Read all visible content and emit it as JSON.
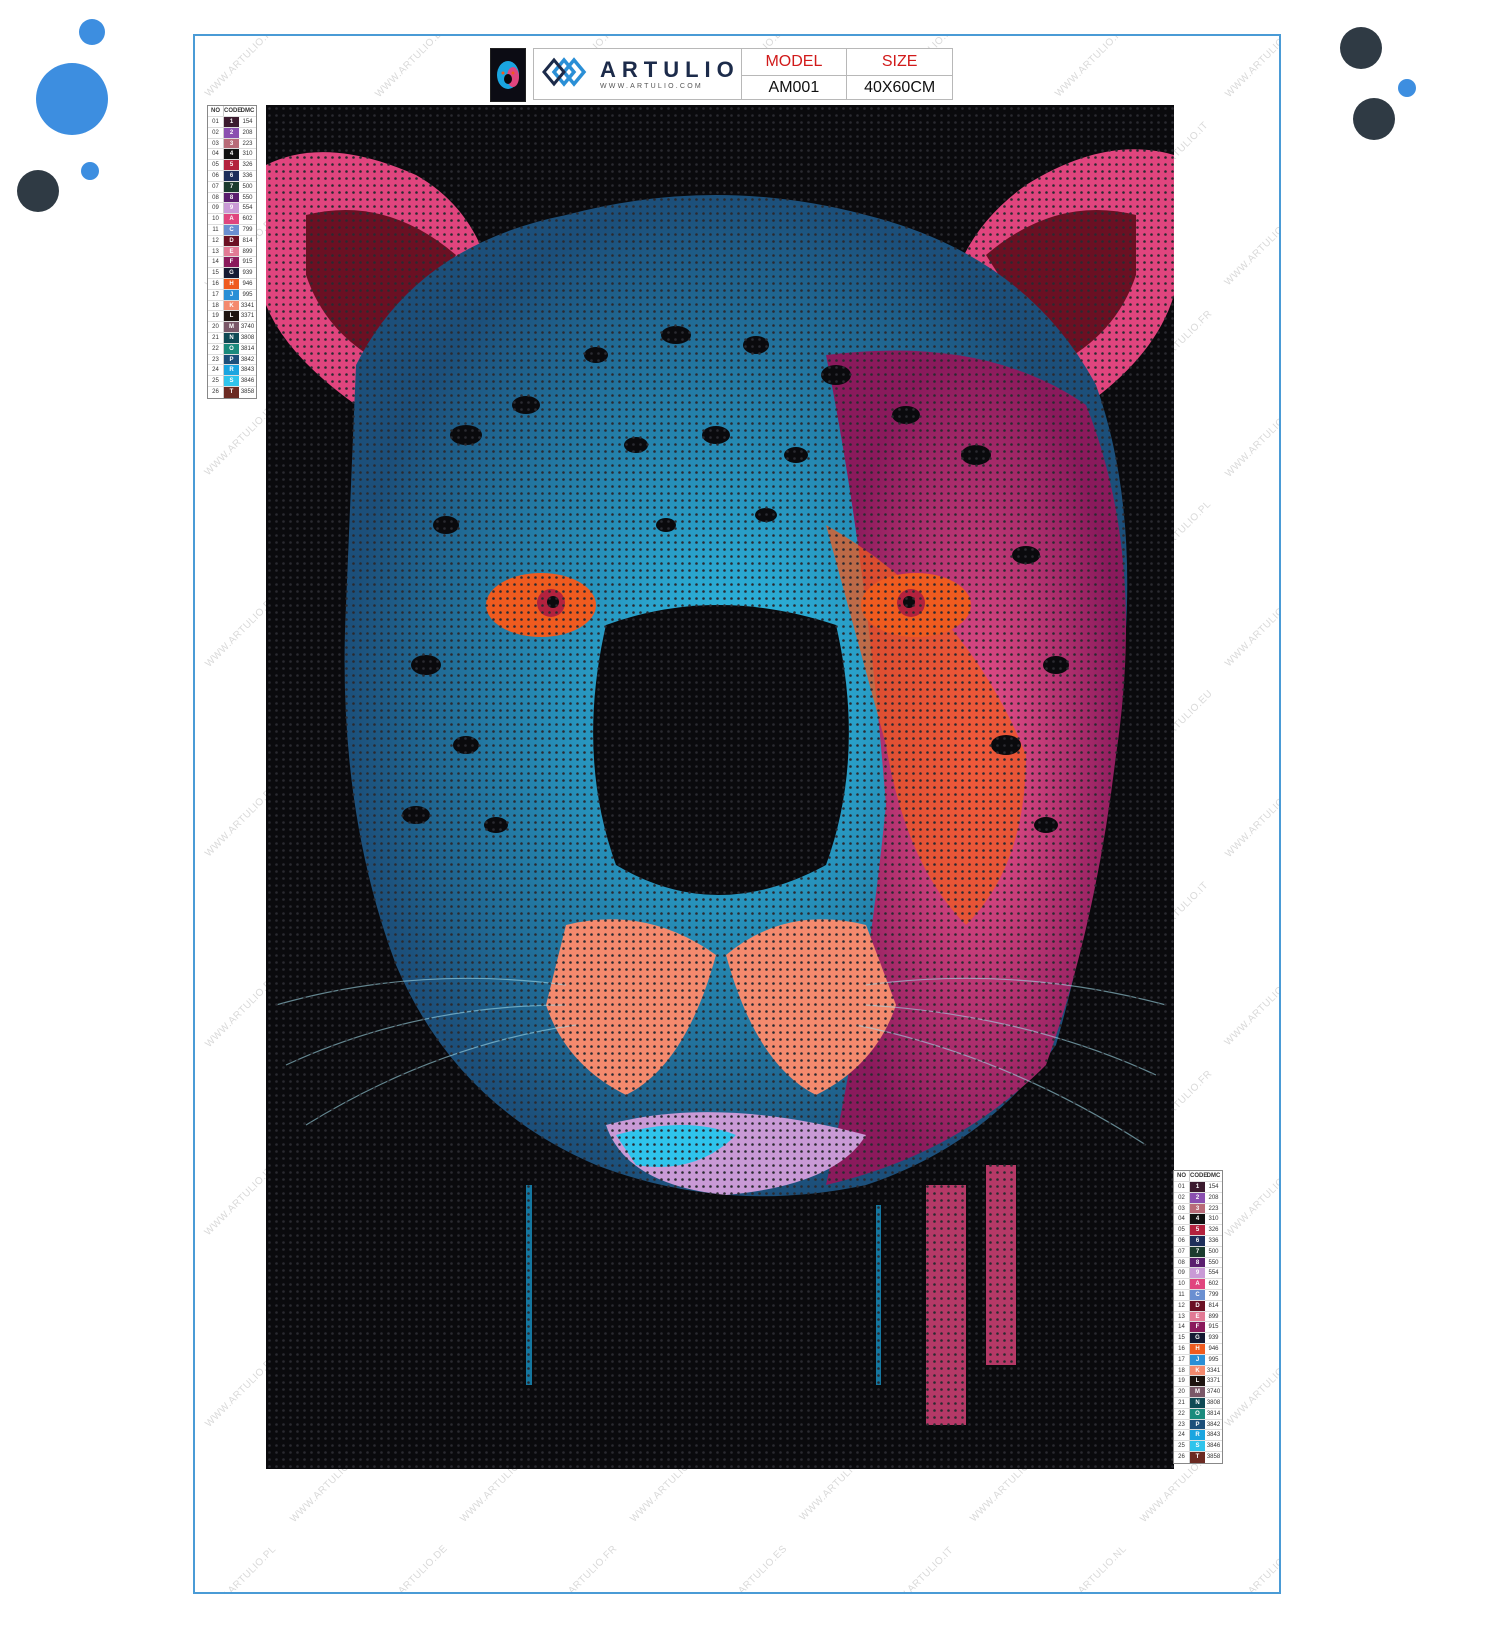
{
  "decor": {
    "blue": "#3d8ee0",
    "dark": "#2f3a44"
  },
  "brand": {
    "name": "ARTULIO",
    "url": "WWW.ARTULIO.COM",
    "logo_icon": "diamond-logo-icon"
  },
  "product": {
    "model_label": "MODEL",
    "model_value": "AM001",
    "size_label": "SIZE",
    "size_value": "40X60CM"
  },
  "watermark": {
    "texts": [
      "WWW.ARTULIO.PL",
      "WWW.ARTULIO.DE",
      "WWW.ARTULIO.FR",
      "WWW.ARTULIO.ES",
      "WWW.ARTULIO.IT",
      "WWW.ARTULIO.NL",
      "WWW.ARTULIO.EU",
      "WWW.ARTULIO.CO.UK"
    ]
  },
  "legend": {
    "headers": [
      "NO",
      "CODE",
      "DMC"
    ],
    "rows": [
      {
        "no": "01",
        "code": "1",
        "dmc": "154",
        "color": "#3b1a2e"
      },
      {
        "no": "02",
        "code": "2",
        "dmc": "208",
        "color": "#8b4fb0"
      },
      {
        "no": "03",
        "code": "3",
        "dmc": "223",
        "color": "#b86b78"
      },
      {
        "no": "04",
        "code": "4",
        "dmc": "310",
        "color": "#111111"
      },
      {
        "no": "05",
        "code": "5",
        "dmc": "326",
        "color": "#b3223e"
      },
      {
        "no": "06",
        "code": "6",
        "dmc": "336",
        "color": "#1d2e5a"
      },
      {
        "no": "07",
        "code": "7",
        "dmc": "500",
        "color": "#1b3b2e"
      },
      {
        "no": "08",
        "code": "8",
        "dmc": "550",
        "color": "#5a1e6e"
      },
      {
        "no": "09",
        "code": "9",
        "dmc": "554",
        "color": "#c99ad6"
      },
      {
        "no": "10",
        "code": "A",
        "dmc": "602",
        "color": "#e0457e"
      },
      {
        "no": "11",
        "code": "C",
        "dmc": "799",
        "color": "#6a8fd1"
      },
      {
        "no": "12",
        "code": "D",
        "dmc": "814",
        "color": "#6b1023"
      },
      {
        "no": "13",
        "code": "E",
        "dmc": "899",
        "color": "#e27a95"
      },
      {
        "no": "14",
        "code": "F",
        "dmc": "915",
        "color": "#8a1a5c"
      },
      {
        "no": "15",
        "code": "G",
        "dmc": "939",
        "color": "#151a33"
      },
      {
        "no": "16",
        "code": "H",
        "dmc": "946",
        "color": "#ef5b1f"
      },
      {
        "no": "17",
        "code": "J",
        "dmc": "995",
        "color": "#2a8fd6"
      },
      {
        "no": "18",
        "code": "K",
        "dmc": "3341",
        "color": "#f48a6e"
      },
      {
        "no": "19",
        "code": "L",
        "dmc": "3371",
        "color": "#1e1410"
      },
      {
        "no": "20",
        "code": "M",
        "dmc": "3740",
        "color": "#7a5868"
      },
      {
        "no": "21",
        "code": "N",
        "dmc": "3808",
        "color": "#0f4a55"
      },
      {
        "no": "22",
        "code": "O",
        "dmc": "3814",
        "color": "#1a8a7c"
      },
      {
        "no": "23",
        "code": "P",
        "dmc": "3842",
        "color": "#1c4f7a"
      },
      {
        "no": "24",
        "code": "R",
        "dmc": "3843",
        "color": "#1aa5e0"
      },
      {
        "no": "25",
        "code": "S",
        "dmc": "3846",
        "color": "#2fc4ec"
      },
      {
        "no": "26",
        "code": "T",
        "dmc": "3858",
        "color": "#6b2a22"
      }
    ]
  }
}
